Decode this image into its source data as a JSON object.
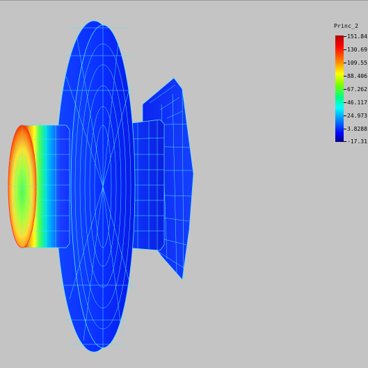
{
  "legend": {
    "title": "Princ_2",
    "values": [
      "151.84",
      "130.69",
      "109.55",
      "88.406",
      "67.262",
      "46.117",
      "24.973",
      "3.8288",
      "-17.31"
    ]
  },
  "colors": {
    "background": "#c4c4c4",
    "mesh_line": "#55e6ff",
    "body_blue": "#1a2fff",
    "hot": "#ff0000"
  }
}
